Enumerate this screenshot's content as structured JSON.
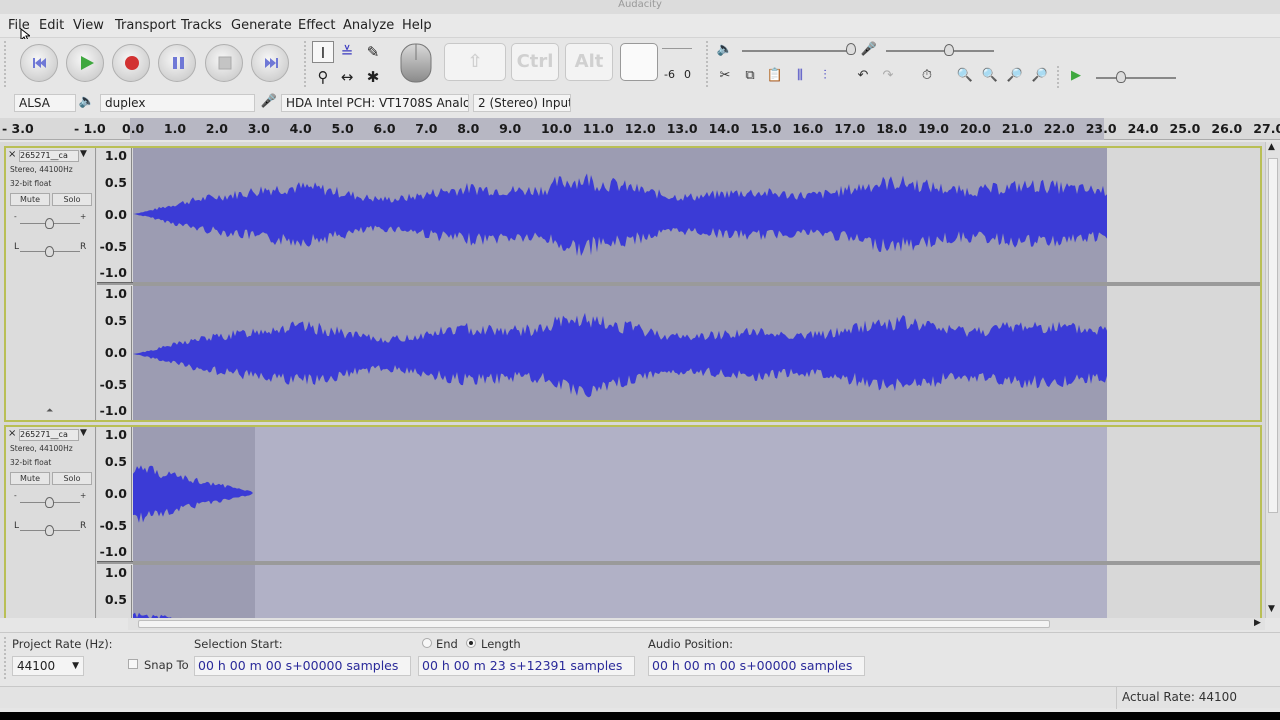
{
  "window": {
    "title": "Audacity"
  },
  "menu": [
    "File",
    "Edit",
    "View",
    "Transport",
    "Tracks",
    "Generate",
    "Effect",
    "Analyze",
    "Help"
  ],
  "transport": {
    "buttons": [
      "skip-to-start",
      "play",
      "record",
      "pause",
      "stop",
      "skip-to-end"
    ]
  },
  "tools": {
    "row1": [
      "selection-tool",
      "envelope-tool",
      "draw-tool"
    ],
    "row2": [
      "zoom-tool",
      "time-shift-tool",
      "multi-tool"
    ]
  },
  "keyboard_overlay": {
    "keys": [
      "⇧",
      "Ctrl",
      "Alt",
      ""
    ]
  },
  "meter": {
    "scale_left": "-6",
    "scale_right": "0"
  },
  "devices": {
    "host": "ALSA",
    "output_device": "duplex",
    "input_device": "HDA Intel PCH: VT1708S Analog",
    "input_channels": "2 (Stereo) Input"
  },
  "ruler": {
    "ticks": [
      "- 3.0",
      "- 1.0",
      "0.0",
      "1.0",
      "2.0",
      "3.0",
      "4.0",
      "5.0",
      "6.0",
      "7.0",
      "8.0",
      "9.0",
      "10.0",
      "11.0",
      "12.0",
      "13.0",
      "14.0",
      "15.0",
      "16.0",
      "17.0",
      "18.0",
      "19.0",
      "20.0",
      "21.0",
      "22.0",
      "23.0",
      "24.0",
      "25.0",
      "26.0",
      "27.0"
    ]
  },
  "tracks": [
    {
      "name": "265271__ca",
      "format": "Stereo, 44100Hz",
      "bits": "32-bit float",
      "mute": "Mute",
      "solo": "Solo",
      "gain_minus": "-",
      "gain_plus": "+",
      "pan_left": "L",
      "pan_right": "R",
      "scale": [
        "1.0",
        "0.5",
        "0.0",
        "-0.5",
        "-1.0"
      ]
    },
    {
      "name": "265271__ca",
      "format": "Stereo, 44100Hz",
      "bits": "32-bit float",
      "mute": "Mute",
      "solo": "Solo",
      "gain_minus": "-",
      "gain_plus": "+",
      "pan_left": "L",
      "pan_right": "R",
      "scale": [
        "1.0",
        "0.5",
        "0.0",
        "-0.5",
        "-1.0"
      ],
      "scale_lower_partial": [
        "1.0",
        "0.5"
      ]
    }
  ],
  "selection_toolbar": {
    "project_rate_label": "Project Rate (Hz):",
    "project_rate": "44100",
    "snap_to": "Snap To",
    "selection_start_label": "Selection Start:",
    "selection_start": "00 h 00 m 00 s+00000 samples",
    "end_label": "End",
    "length_label": "Length",
    "length": "00 h 00 m 23 s+12391 samples",
    "audio_position_label": "Audio Position:",
    "audio_position": "00 h 00 m 00 s+00000 samples"
  },
  "status": {
    "actual_rate": "Actual Rate: 44100"
  },
  "colors": {
    "waveform": "#3b3bd6",
    "selection_bg": "#9c9cb2",
    "track_bg": "#b1b1c6",
    "track_border": "#b9bf55"
  }
}
